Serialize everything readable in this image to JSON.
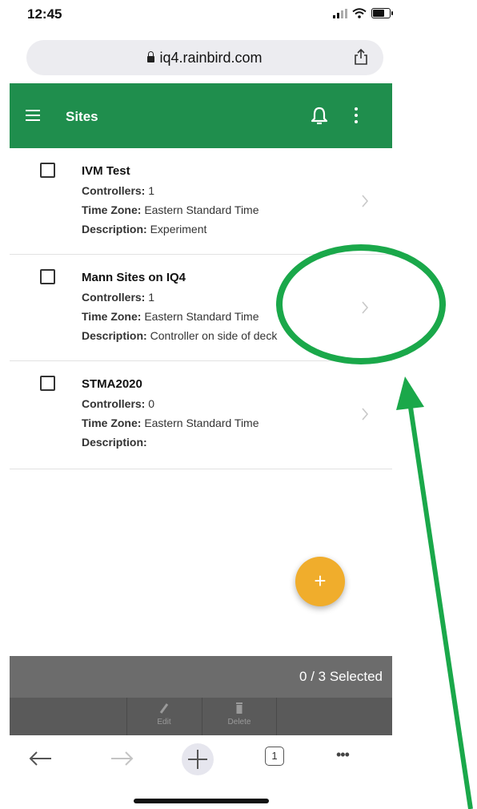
{
  "status_bar": {
    "time": "12:45"
  },
  "browser": {
    "url": "iq4.rainbird.com"
  },
  "app_bar": {
    "title": "Sites"
  },
  "sites": [
    {
      "name": "IVM Test",
      "controllers_label": "Controllers:",
      "controllers": "1",
      "timezone_label": "Time Zone:",
      "timezone": "Eastern Standard Time",
      "description_label": "Description:",
      "description": "Experiment"
    },
    {
      "name": "Mann Sites on IQ4",
      "controllers_label": "Controllers:",
      "controllers": "1",
      "timezone_label": "Time Zone:",
      "timezone": "Eastern Standard Time",
      "description_label": "Description:",
      "description": "Controller on side of deck"
    },
    {
      "name": "STMA2020",
      "controllers_label": "Controllers:",
      "controllers": "0",
      "timezone_label": "Time Zone:",
      "timezone": "Eastern Standard Time",
      "description_label": "Description:",
      "description": ""
    }
  ],
  "fab": {
    "label": "+"
  },
  "selection": {
    "text": "0 / 3 Selected"
  },
  "actions": {
    "edit_label": "Edit",
    "delete_label": "Delete"
  },
  "toolbar": {
    "tabs_count": "1",
    "more_label": "•••"
  },
  "colors": {
    "header": "#1f8e4d",
    "fab": "#f0ad2c",
    "annotation": "#1aa84a"
  },
  "icons": [
    "lock-icon",
    "share-icon",
    "menu-icon",
    "bell-icon",
    "more-vert-icon",
    "chevron-right-icon",
    "add-icon",
    "edit-icon",
    "delete-icon",
    "back-arrow-icon",
    "forward-arrow-icon",
    "new-tab-icon",
    "tabs-icon",
    "more-horizontal-icon"
  ]
}
